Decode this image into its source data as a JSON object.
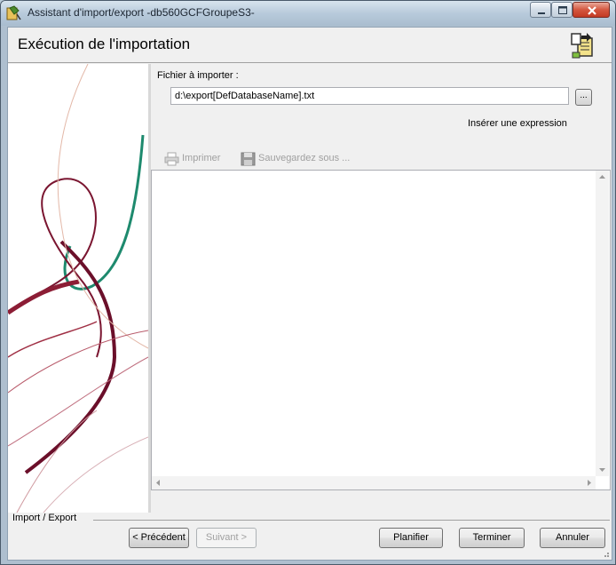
{
  "window": {
    "title": "Assistant d'import/export -db560GCFGroupeS3-",
    "icons": {
      "app": "wizard-app-icon",
      "minimize": "minimize-icon",
      "maximize": "maximize-icon",
      "close": "close-icon"
    }
  },
  "header": {
    "title": "Exécution de l'importation",
    "icon": "import-export-icon"
  },
  "form": {
    "file_label": "Fichier à importer :",
    "file_value": "d:\\export[DefDatabaseName].txt",
    "browse_label": "...",
    "insert_expression": "Insérer une expression"
  },
  "toolbar": {
    "print_label": "Imprimer",
    "save_as_label": "Sauvegardez sous ...",
    "print_icon": "printer-icon",
    "save_icon": "floppy-disk-icon"
  },
  "output": {
    "content": ""
  },
  "footer": {
    "group_label": "Import / Export",
    "prev_label": "< Précédent",
    "next_label": "Suivant >",
    "schedule_label": "Planifier",
    "finish_label": "Terminer",
    "cancel_label": "Annuler"
  }
}
